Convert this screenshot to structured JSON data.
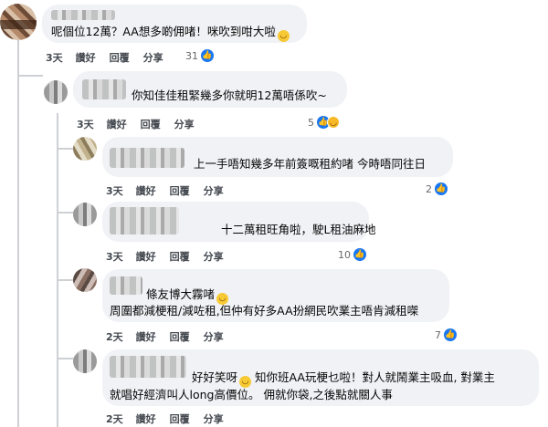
{
  "comments": [
    {
      "text": "呢個位12萬？AA想多啲佣啫！咪吹到咁大啦",
      "text_emoji": "😂",
      "time": "3天",
      "like_label": "讚好",
      "reply_label": "回覆",
      "share_label": "分享",
      "reaction_count": "31",
      "reaction_types": [
        "like"
      ]
    },
    {
      "text": "你知佳佳租緊幾多你就明12萬唔係吹~",
      "time": "3天",
      "like_label": "讚好",
      "reply_label": "回覆",
      "share_label": "分享",
      "reaction_count": "5",
      "reaction_types": [
        "like",
        "haha"
      ]
    },
    {
      "text": "上一手唔知幾多年前簽嘅租約啫 今時唔同往日",
      "time": "3天",
      "like_label": "讚好",
      "reply_label": "回覆",
      "share_label": "分享",
      "reaction_count": "2",
      "reaction_types": [
        "like"
      ]
    },
    {
      "text": "十二萬租旺角啦，駛L租油麻地",
      "time": "3天",
      "like_label": "讚好",
      "reply_label": "回覆",
      "share_label": "分享",
      "reaction_count": "10",
      "reaction_types": [
        "like"
      ]
    },
    {
      "text_line1": "條友博大霧啫",
      "text_line1_emoji": "😬",
      "text_line2": "周圍都減梗租/減咗租,但仲有好多AA扮網民吹業主唔肯減租㗎",
      "time": "2天",
      "like_label": "讚好",
      "reply_label": "回覆",
      "share_label": "分享",
      "reaction_count": "7",
      "reaction_types": [
        "like"
      ]
    },
    {
      "text_line1a": "好好笑呀",
      "text_line1_emoji": "😬",
      "text_line1b": "知你班AA玩梗乜啦！對人就鬧業主吸血, 對業主",
      "text_line2": "就唱好經濟叫人long高價位。 佣就你袋,之後點就關人事",
      "time": "2天",
      "like_label": "讚好",
      "reply_label": "回覆",
      "share_label": "分享"
    }
  ],
  "colors": {
    "bubble": "#f0f2f5",
    "like_blue": "#1877f2",
    "action_text": "#444950",
    "thread_line": "#ced0d4"
  }
}
